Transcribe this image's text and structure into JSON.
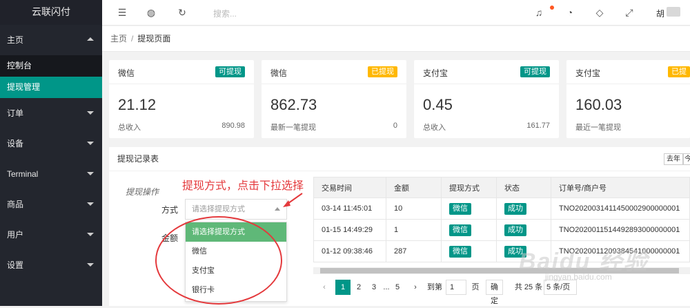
{
  "sidebar": {
    "logo": "云联闪付",
    "items": [
      {
        "label": "主页",
        "expanded": true,
        "children": [
          {
            "label": "控制台",
            "active": false
          },
          {
            "label": "提现管理",
            "active": true
          }
        ]
      },
      {
        "label": "订单"
      },
      {
        "label": "设备"
      },
      {
        "label": "Terminal"
      },
      {
        "label": "商品"
      },
      {
        "label": "用户"
      },
      {
        "label": "设置"
      }
    ]
  },
  "topbar": {
    "search_placeholder": "搜索...",
    "user": "胡"
  },
  "breadcrumb": {
    "home": "主页",
    "sep": "/",
    "current": "提现页面"
  },
  "cards": [
    {
      "title": "微信",
      "badge": "可提现",
      "badge_color": "#009688",
      "value": "21.12",
      "label": "总收入",
      "right": "890.98"
    },
    {
      "title": "微信",
      "badge": "已提现",
      "badge_color": "#ffb800",
      "value": "862.73",
      "label": "最新一笔提现",
      "right": "0"
    },
    {
      "title": "支付宝",
      "badge": "可提现",
      "badge_color": "#009688",
      "value": "0.45",
      "label": "总收入",
      "right": "161.77"
    },
    {
      "title": "支付宝",
      "badge": "已提",
      "badge_color": "#ffb800",
      "value": "160.03",
      "label": "最近一笔提现",
      "right": ""
    }
  ],
  "panel": {
    "title": "提现记录表",
    "year_btn": "去年",
    "year_btn2": "今",
    "form_title": "提现操作",
    "method_label": "方式",
    "amount_label": "金额",
    "select_placeholder": "请选择提现方式",
    "options": [
      "请选择提现方式",
      "微信",
      "支付宝",
      "银行卡"
    ],
    "annotation": "提现方式，点击下拉选择"
  },
  "table": {
    "headers": [
      "交易时间",
      "金额",
      "提现方式",
      "状态",
      "订单号/商户号"
    ],
    "rows": [
      {
        "time": "03-14 11:45:01",
        "amount": "10",
        "method": "微信",
        "status": "成功",
        "order": "TNO2020031411450002900000001"
      },
      {
        "time": "01-15 14:49:29",
        "amount": "1",
        "method": "微信",
        "status": "成功",
        "order": "TNO2020011514492893000000001"
      },
      {
        "time": "01-12 09:38:46",
        "amount": "287",
        "method": "微信",
        "status": "成功",
        "order": "TNO2020011209384541000000001"
      }
    ]
  },
  "pager": {
    "pages": [
      "1",
      "2",
      "3",
      "...",
      "5"
    ],
    "goto": "到第",
    "goto_value": "1",
    "page_unit": "页",
    "confirm": "确定",
    "total": "共 25 条",
    "per_page": "5 条/页"
  },
  "watermark": {
    "main": "Baidu 经验",
    "sub": "jingyan.baidu.com"
  }
}
